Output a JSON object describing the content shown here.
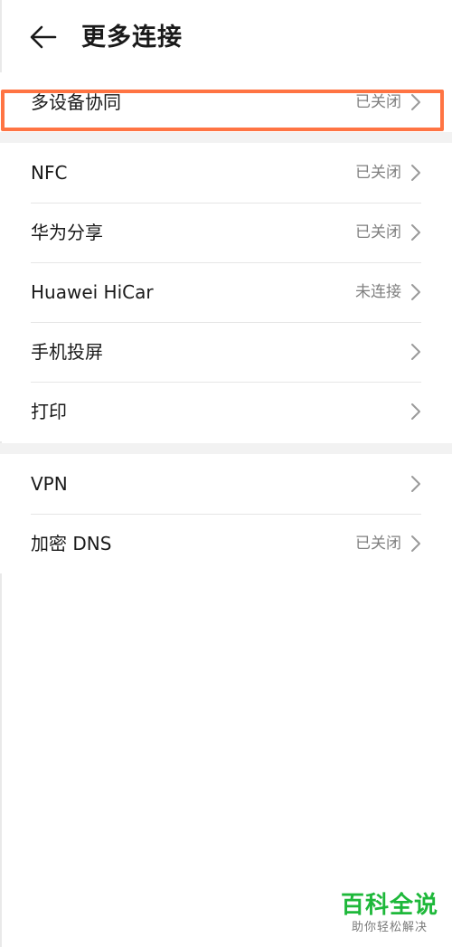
{
  "header": {
    "title": "更多连接",
    "back_icon": "arrow-left-icon"
  },
  "section1": {
    "items": [
      {
        "label": "多设备协同",
        "status": "已关闭"
      }
    ]
  },
  "section2": {
    "items": [
      {
        "label": "NFC",
        "status": "已关闭"
      },
      {
        "label": "华为分享",
        "status": "已关闭"
      },
      {
        "label": "Huawei HiCar",
        "status": "未连接"
      },
      {
        "label": "手机投屏",
        "status": ""
      },
      {
        "label": "打印",
        "status": ""
      }
    ]
  },
  "section3": {
    "items": [
      {
        "label": "VPN",
        "status": ""
      },
      {
        "label": "加密 DNS",
        "status": "已关闭"
      }
    ]
  },
  "highlight_color": "#ff7443",
  "watermark": {
    "title": "百科全说",
    "subtitle": "助你轻松解决",
    "color": "#1eb83a"
  }
}
